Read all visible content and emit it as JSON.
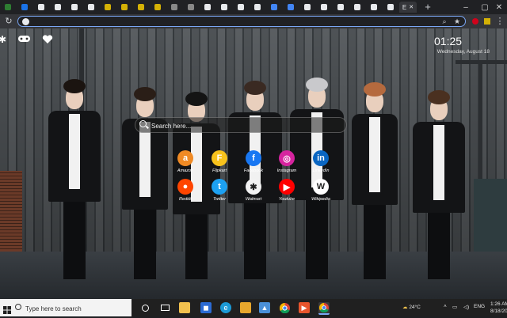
{
  "browser": {
    "tabs": [
      {
        "favicon_color": "#2e7d32"
      },
      {
        "favicon_color": "#1a73e8"
      },
      {
        "favicon_color": "#e8eaed"
      },
      {
        "favicon_color": "#e8eaed"
      },
      {
        "favicon_color": "#e8eaed"
      },
      {
        "favicon_color": "#e8eaed"
      },
      {
        "favicon_color": "#d4b106"
      },
      {
        "favicon_color": "#d4b106"
      },
      {
        "favicon_color": "#d4b106"
      },
      {
        "favicon_color": "#d4b106"
      },
      {
        "favicon_color": "#888888"
      },
      {
        "favicon_color": "#888888"
      },
      {
        "favicon_color": "#e8eaed"
      },
      {
        "favicon_color": "#e8eaed"
      },
      {
        "favicon_color": "#e8eaed"
      },
      {
        "favicon_color": "#e8eaed"
      },
      {
        "favicon_color": "#4285f4"
      },
      {
        "favicon_color": "#4285f4"
      },
      {
        "favicon_color": "#e8eaed"
      },
      {
        "favicon_color": "#e8eaed"
      },
      {
        "favicon_color": "#e8eaed"
      },
      {
        "favicon_color": "#e8eaed"
      },
      {
        "favicon_color": "#e8eaed"
      },
      {
        "favicon_color": "#e8eaed"
      }
    ],
    "active_tab_label": "E",
    "new_tab_label": "+",
    "address_value": "",
    "toolbar_icons": [
      "back-icon",
      "forward-icon",
      "reload-icon",
      "search-icon",
      "star-icon",
      "extension-icon",
      "profile-icon",
      "menu-icon"
    ]
  },
  "newtab": {
    "clock": "01:25",
    "date": "Wednesday, August 18",
    "search_placeholder": "Search here...",
    "top_icons": [
      "puzzle-icon",
      "gamepad-icon",
      "heart-icon"
    ],
    "shortcuts": [
      {
        "label": "Amazon",
        "glyph": "a",
        "color": "#f08a24"
      },
      {
        "label": "Flipkart",
        "glyph": "F",
        "color": "#f7c21c"
      },
      {
        "label": "Facebook",
        "glyph": "f",
        "color": "#1877f2"
      },
      {
        "label": "Instagram",
        "glyph": "◎",
        "color": "#d6249f"
      },
      {
        "label": "LinkedIn",
        "glyph": "in",
        "color": "#0a66c2"
      },
      {
        "label": "Reddit",
        "glyph": "●",
        "color": "#ff4500"
      },
      {
        "label": "Twitter",
        "glyph": "t",
        "color": "#1da1f2"
      },
      {
        "label": "Walmart",
        "glyph": "✱",
        "color": "#f2f2f2"
      },
      {
        "label": "Youtube",
        "glyph": "▶",
        "color": "#ff0000"
      },
      {
        "label": "Wikipedia",
        "glyph": "W",
        "color": "#ffffff"
      }
    ]
  },
  "taskbar": {
    "search_placeholder": "Type here to search",
    "weather": "24°C",
    "lang": "ENG",
    "time": "1:26 AM",
    "date": "8/18/20"
  }
}
